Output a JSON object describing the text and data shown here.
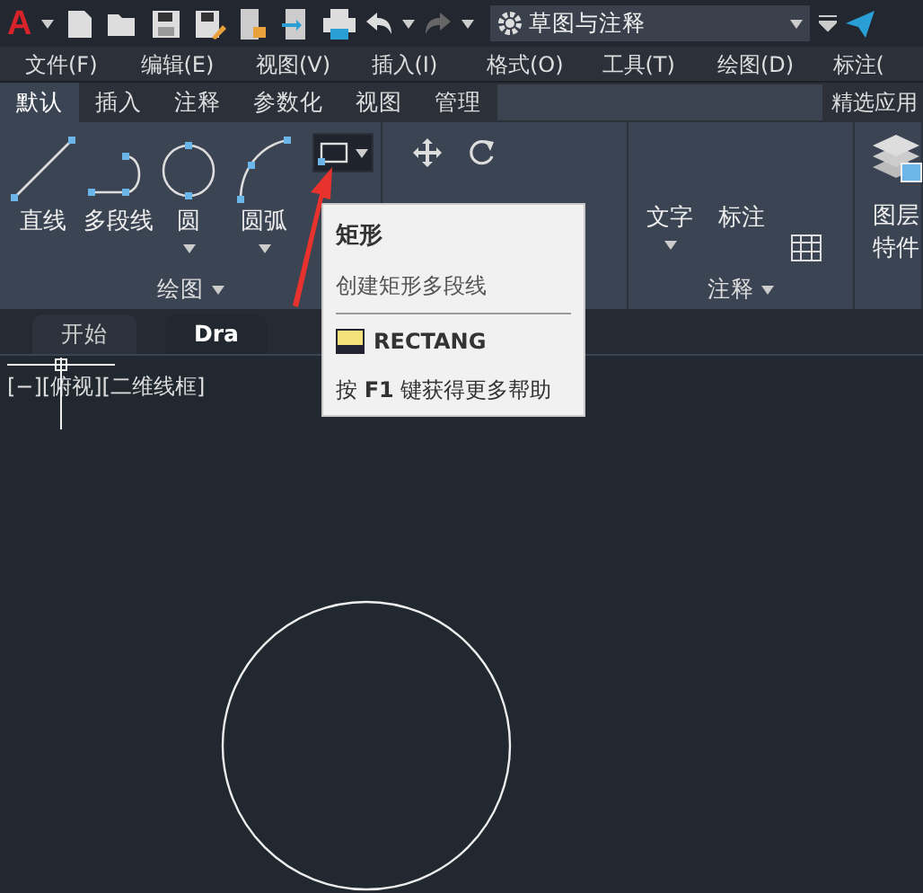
{
  "title_bar": {
    "logo": "A",
    "workspace": "草图与注释"
  },
  "menu": [
    "文件(F)",
    "编辑(E)",
    "视图(V)",
    "插入(I)",
    "格式(O)",
    "工具(T)",
    "绘图(D)",
    "标注("
  ],
  "ribbon_tabs": [
    {
      "label": "默认",
      "selected": true
    },
    {
      "label": "插入",
      "selected": false
    },
    {
      "label": "注释",
      "selected": false
    },
    {
      "label": "参数化",
      "selected": false
    },
    {
      "label": "视图",
      "selected": false
    },
    {
      "label": "管理",
      "selected": false
    }
  ],
  "featured_apps": "精选应用",
  "panels": [
    {
      "label": "绘图",
      "tools": [
        {
          "kind": "line",
          "label": "直线",
          "dropdown": false
        },
        {
          "kind": "polyline",
          "label": "多段线",
          "dropdown": false
        },
        {
          "kind": "circle",
          "label": "圆",
          "dropdown": true
        },
        {
          "kind": "arc",
          "label": "圆弧",
          "dropdown": true
        },
        {
          "kind": "rectangle",
          "active": true
        }
      ]
    },
    {
      "tools": [
        {
          "kind": "move"
        },
        {
          "kind": "rotate"
        }
      ]
    },
    {
      "label": "注释",
      "tools": [
        {
          "kind": "text",
          "label": "文字",
          "dropdown": true
        },
        {
          "kind": "dimension",
          "label": "标注",
          "dropdown": false
        },
        {
          "kind": "table"
        }
      ]
    },
    {
      "tools": [
        {
          "kind": "layers",
          "label": "图层",
          "label2": "特件"
        }
      ]
    }
  ],
  "file_tabs": [
    {
      "label": "开始",
      "selected": false
    },
    {
      "label": "Dra",
      "selected": true
    }
  ],
  "viewport_label": "[−][俯视][二维线框]",
  "tooltip": {
    "title": "矩形",
    "description": "创建矩形多段线",
    "command": "RECTANG",
    "help": "按 **F1** 键获得更多帮助"
  }
}
